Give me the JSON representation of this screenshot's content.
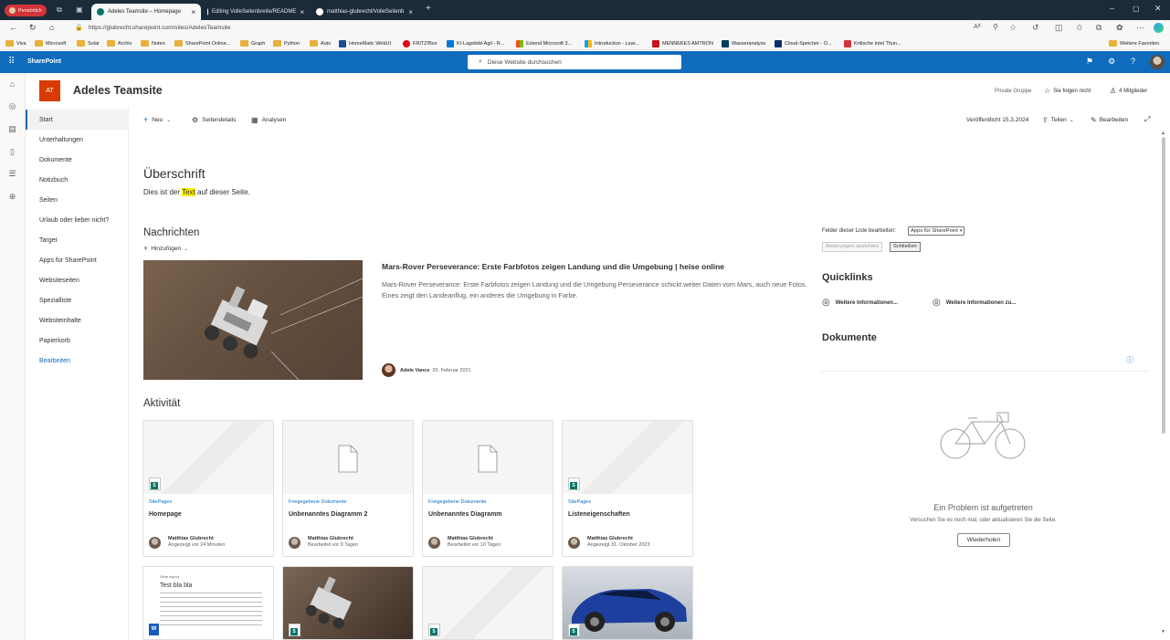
{
  "browser": {
    "profile_label": "Persönlich",
    "tabs": [
      {
        "label": "Adeles Teamsite – Homepage"
      },
      {
        "label": "Editing VolleSeitenbreite/README"
      },
      {
        "label": "matthias-glubrecht/VolleSeitenb"
      }
    ],
    "url": "https://glubrecht.sharepoint.com/sites/AdelesTeamsite",
    "favorites": [
      "Viva",
      "Microsoft",
      "Solar",
      "Archiv",
      "Noten",
      "SharePoint Online...",
      "Graph",
      "Python",
      "Auto",
      "HomeMatic WebUI",
      "FRITZ!Box",
      "KI-Lagebild-Agil - R...",
      "Extend Microsoft 3...",
      "Introduction - Lear...",
      "MENNEKES AMTRON",
      "Wasseranalyse",
      "Cloud-Speicher - O...",
      "Kritische Intel Thun..."
    ],
    "other_favorites": "Weitere Favoriten"
  },
  "suitebar": {
    "app_name": "SharePoint",
    "search_placeholder": "Diese Website durchsuchen"
  },
  "site": {
    "logo_text": "AT",
    "title": "Adeles Teamsite",
    "group_type": "Private Gruppe",
    "follow": "Sie folgen nicht",
    "members": "4 Mitglieder"
  },
  "nav": [
    "Start",
    "Unterhaltungen",
    "Dokumente",
    "Notizbuch",
    "Seiten",
    "Urlaub oder lieber nicht?",
    "Target",
    "Apps für SharePoint",
    "Websiteseiten",
    "Spezialliste",
    "Websiteinhalte",
    "Papierkorb",
    "Bearbeiten"
  ],
  "commandbar": {
    "new": "Neu",
    "page_details": "Seitendetails",
    "analytics": "Analysen",
    "published": "Veröffentlicht 15.3.2024",
    "share": "Teilen",
    "edit": "Bearbeiten"
  },
  "content": {
    "heading": "Überschrift",
    "text_before": "Dies ist der ",
    "text_highlight": "Text",
    "text_after": " auf dieser Seite.",
    "news_title": "Nachrichten",
    "news_add": "Hinzufügen",
    "news_item_title": "Mars-Rover Perseverance: Erste Farbfotos zeigen Landung und die Umgebung | heise online",
    "news_item_desc": "Mars-Rover Perseverance: Erste Farbfotos zeigen Landung und die Umgebung Perseverance schickt weiter Daten vom Mars, auch neue Fotos. Eines zeigt den Landeanflug, ein anderes die Umgebung in Farbe.",
    "news_author": "Adele Vance",
    "news_date": "20. Februar 2021",
    "activity_title": "Aktivität"
  },
  "activity_cards": [
    {
      "category": "SitePages",
      "title": "Homepage",
      "author": "Matthias Glubrecht",
      "meta": "Angezeigt vor 24 Minuten"
    },
    {
      "category": "Freigegebene Dokumente",
      "title": "Unbenanntes Diagramm 2",
      "author": "Matthias Glubrecht",
      "meta": "Bearbeitet vor 9 Tagen"
    },
    {
      "category": "Freigegebene Dokumente",
      "title": "Unbenanntes Diagramm",
      "author": "Matthias Glubrecht",
      "meta": "Bearbeitet vor 10 Tagen"
    },
    {
      "category": "SitePages",
      "title": "Listeneigenschaften",
      "author": "Matthias Glubrecht",
      "meta": "Angezeigt 31. Oktober 2023"
    }
  ],
  "doc_preview": {
    "header": "Seite layout",
    "title": "Test bla bla"
  },
  "right": {
    "fields_label": "Felder dieser Liste bearbeiten:",
    "fields_select": "Apps für SharePoint",
    "save_changes": "Änderungen speichern",
    "close": "Schließen",
    "quicklinks_title": "Quicklinks",
    "quicklink1": "Weitere Informationen...",
    "quicklink2": "Weitere Informationen zu...",
    "documents_title": "Dokumente",
    "error_title": "Ein Problem ist aufgetreten",
    "error_text": "Versuchen Sie es noch mal, oder aktualisieren Sie die Seite.",
    "retry": "Wiederholen"
  }
}
